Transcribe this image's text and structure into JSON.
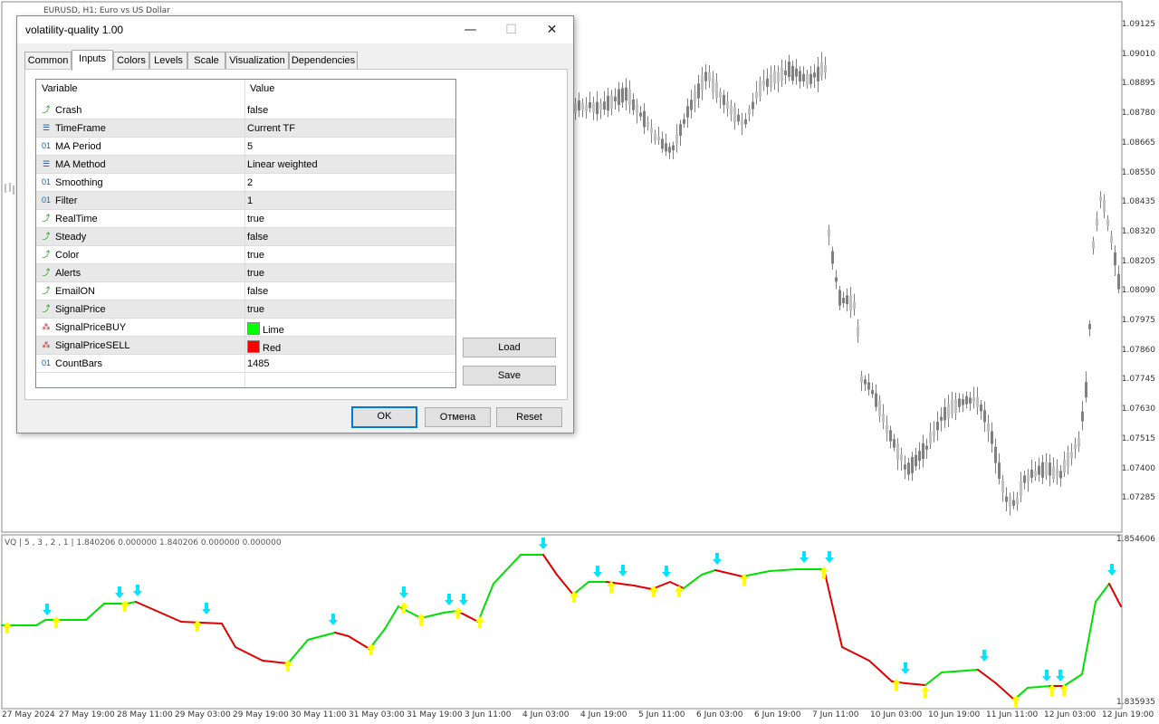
{
  "chart": {
    "title": "EURUSD, H1:  Euro vs US Dollar",
    "price_labels": [
      "1.09125",
      "1.09010",
      "1.08895",
      "1.08780",
      "1.08665",
      "1.08550",
      "1.08435",
      "1.08320",
      "1.08205",
      "1.08090",
      "1.07975",
      "1.07860",
      "1.07745",
      "1.07630",
      "1.07515",
      "1.07400",
      "1.07285"
    ],
    "indicator_labels": [
      "1.854606",
      "1.835935"
    ],
    "indicator_header": "VQ | 5 , 3 , 2 , 1  |  1.840206 0.000000 1.840206 0.000000 0.000000",
    "date_labels": [
      "27 May 2024",
      "27 May 19:00",
      "28 May 11:00",
      "29 May 03:00",
      "29 May 19:00",
      "30 May 11:00",
      "31 May 03:00",
      "31 May 19:00",
      "3 Jun 11:00",
      "4 Jun 03:00",
      "4 Jun 19:00",
      "5 Jun 11:00",
      "6 Jun 03:00",
      "6 Jun 19:00",
      "7 Jun 11:00",
      "10 Jun 03:00",
      "10 Jun 19:00",
      "11 Jun 11:00",
      "12 Jun 03:00",
      "12 Jun 19:00"
    ],
    "colors": {
      "up_line": "#00e000",
      "down_line": "#e00000",
      "buy_arrow": "#ffff00",
      "sell_arrow": "#00e5ff",
      "candle": "#808080"
    }
  },
  "dialog": {
    "title": "volatility-quality 1.00",
    "minimize": "—",
    "maximize": "☐",
    "close": "✕",
    "tabs": [
      "Common",
      "Inputs",
      "Colors",
      "Levels",
      "Scale",
      "Visualization",
      "Dependencies"
    ],
    "active_tab": "Inputs",
    "columns": {
      "variable": "Variable",
      "value": "Value"
    },
    "rows": [
      {
        "icon": "bool-icon",
        "name": "Crash",
        "value": "false"
      },
      {
        "icon": "enum-icon",
        "name": "TimeFrame",
        "value": "Current TF"
      },
      {
        "icon": "int-icon",
        "name": "MA Period",
        "value": "5"
      },
      {
        "icon": "enum-icon",
        "name": "MA Method",
        "value": "Linear weighted"
      },
      {
        "icon": "int-icon",
        "name": "Smoothing",
        "value": "2"
      },
      {
        "icon": "int-icon",
        "name": "Filter",
        "value": "1"
      },
      {
        "icon": "bool-icon",
        "name": "RealTime",
        "value": "true"
      },
      {
        "icon": "bool-icon",
        "name": "Steady",
        "value": "false"
      },
      {
        "icon": "bool-icon",
        "name": "Color",
        "value": "true"
      },
      {
        "icon": "bool-icon",
        "name": "Alerts",
        "value": "true"
      },
      {
        "icon": "bool-icon",
        "name": "EmailON",
        "value": "false"
      },
      {
        "icon": "bool-icon",
        "name": "SignalPrice",
        "value": "true"
      },
      {
        "icon": "color-icon",
        "name": "SignalPriceBUY",
        "value": "Lime",
        "swatch": "#00ff00"
      },
      {
        "icon": "color-icon",
        "name": "SignalPriceSELL",
        "value": "Red",
        "swatch": "#ff0000"
      },
      {
        "icon": "int-icon",
        "name": "CountBars",
        "value": "1485"
      }
    ],
    "load": "Load",
    "save": "Save",
    "ok": "OK",
    "cancel": "Отмена",
    "reset": "Reset"
  }
}
